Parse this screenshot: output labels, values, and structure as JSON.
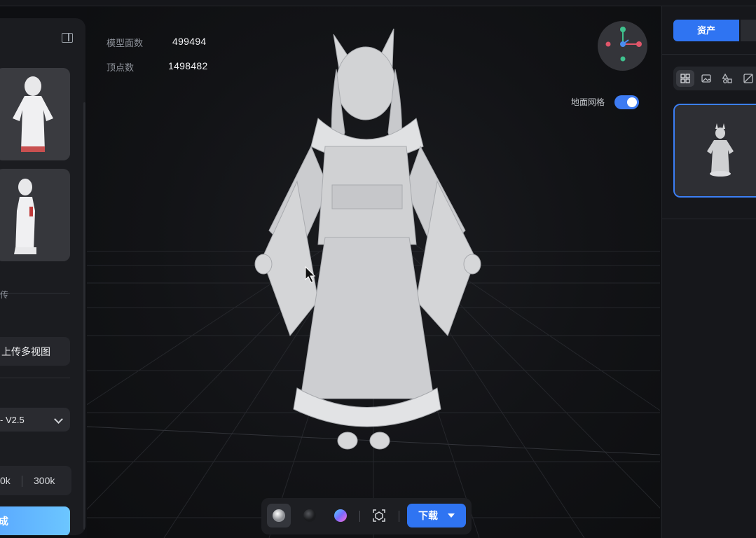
{
  "stats": {
    "faces_label": "模型面数",
    "faces_value": "499494",
    "vertices_label": "顶点数",
    "vertices_value": "1498482"
  },
  "viewport": {
    "ground_grid_label": "地面网格",
    "ground_grid_on": true
  },
  "left_panel": {
    "upload_section_label": "传",
    "upload_multiview_label": "上传多视图",
    "model_version_value": "- V2.5",
    "face_count_options": [
      "0k",
      "300k"
    ],
    "generate_label": "成"
  },
  "right_panel": {
    "tab_assets_label": "资产",
    "filter_icons": [
      "grid-icon",
      "image-icon",
      "shapes-icon",
      "model-icon"
    ]
  },
  "toolbar": {
    "render_modes": [
      "clay-sphere-icon",
      "dark-sphere-icon",
      "color-sphere-icon"
    ],
    "fit_view_icon": "focus-icon",
    "download_label": "下载"
  },
  "colors": {
    "accent": "#2f74f2",
    "generate_gradient_start": "#5aa9ff",
    "generate_gradient_end": "#6cc6ff",
    "gizmo_x": "#e0566a",
    "gizmo_y": "#3fc28e",
    "gizmo_z": "#4a8cf0"
  }
}
